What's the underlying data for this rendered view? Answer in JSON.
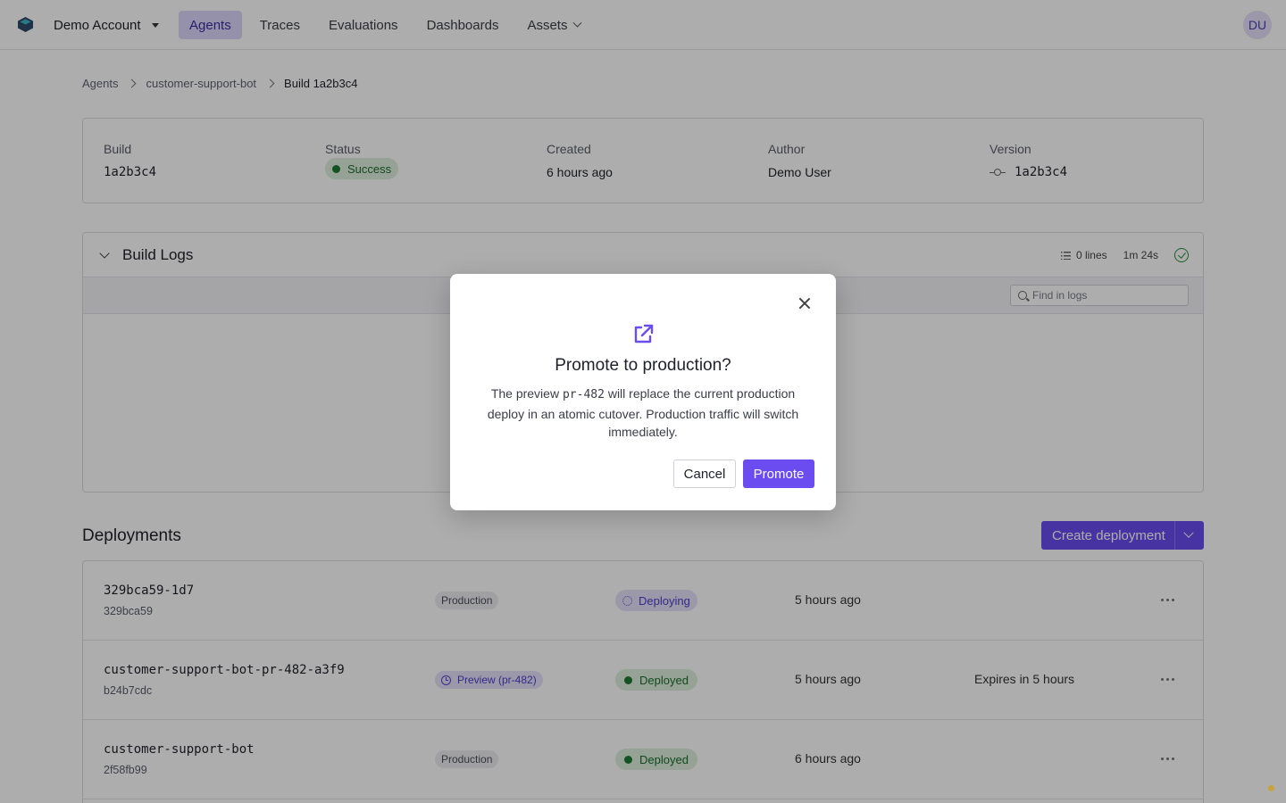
{
  "nav": {
    "account": "Demo Account",
    "items": [
      {
        "label": "Agents",
        "active": true
      },
      {
        "label": "Traces"
      },
      {
        "label": "Evaluations"
      },
      {
        "label": "Dashboards"
      },
      {
        "label": "Assets"
      }
    ],
    "avatar_initials": "DU"
  },
  "breadcrumb": [
    "Agents",
    "customer-support-bot",
    "Build 1a2b3c4"
  ],
  "build": {
    "build_label": "Build",
    "build_value": "1a2b3c4",
    "status_label": "Status",
    "status_value": "Success",
    "created_label": "Created",
    "created_value": "6 hours ago",
    "author_label": "Author",
    "author_value": "Demo User",
    "version_label": "Version",
    "version_value": "1a2b3c4"
  },
  "logs": {
    "title": "Build Logs",
    "lines": "0 lines",
    "duration": "1m 24s",
    "search_placeholder": "Find in logs"
  },
  "deployments": {
    "title": "Deployments",
    "create_label": "Create deployment",
    "rows": [
      {
        "name": "329bca59-1d7",
        "hash": "329bca59",
        "env": "Production",
        "state": "Deploying",
        "time": "5 hours ago",
        "expires": ""
      },
      {
        "name": "customer-support-bot-pr-482-a3f9",
        "hash": "b24b7cdc",
        "env": "Preview (pr-482)",
        "state": "Deployed",
        "time": "5 hours ago",
        "expires": "Expires in 5 hours"
      },
      {
        "name": "customer-support-bot",
        "hash": "2f58fb99",
        "env": "Production",
        "state": "Deployed",
        "time": "6 hours ago",
        "expires": ""
      }
    ]
  },
  "modal": {
    "title": "Promote to production?",
    "body_pre": "The preview ",
    "body_code": "pr-482",
    "body_post": " will replace the current production deploy in an atomic cutover. Production traffic will switch immediately.",
    "cancel": "Cancel",
    "confirm": "Promote"
  },
  "colors": {
    "accent": "#6a4cf0",
    "success": "#1e7a34",
    "overlay": "rgba(0,0,0,0.32)"
  }
}
